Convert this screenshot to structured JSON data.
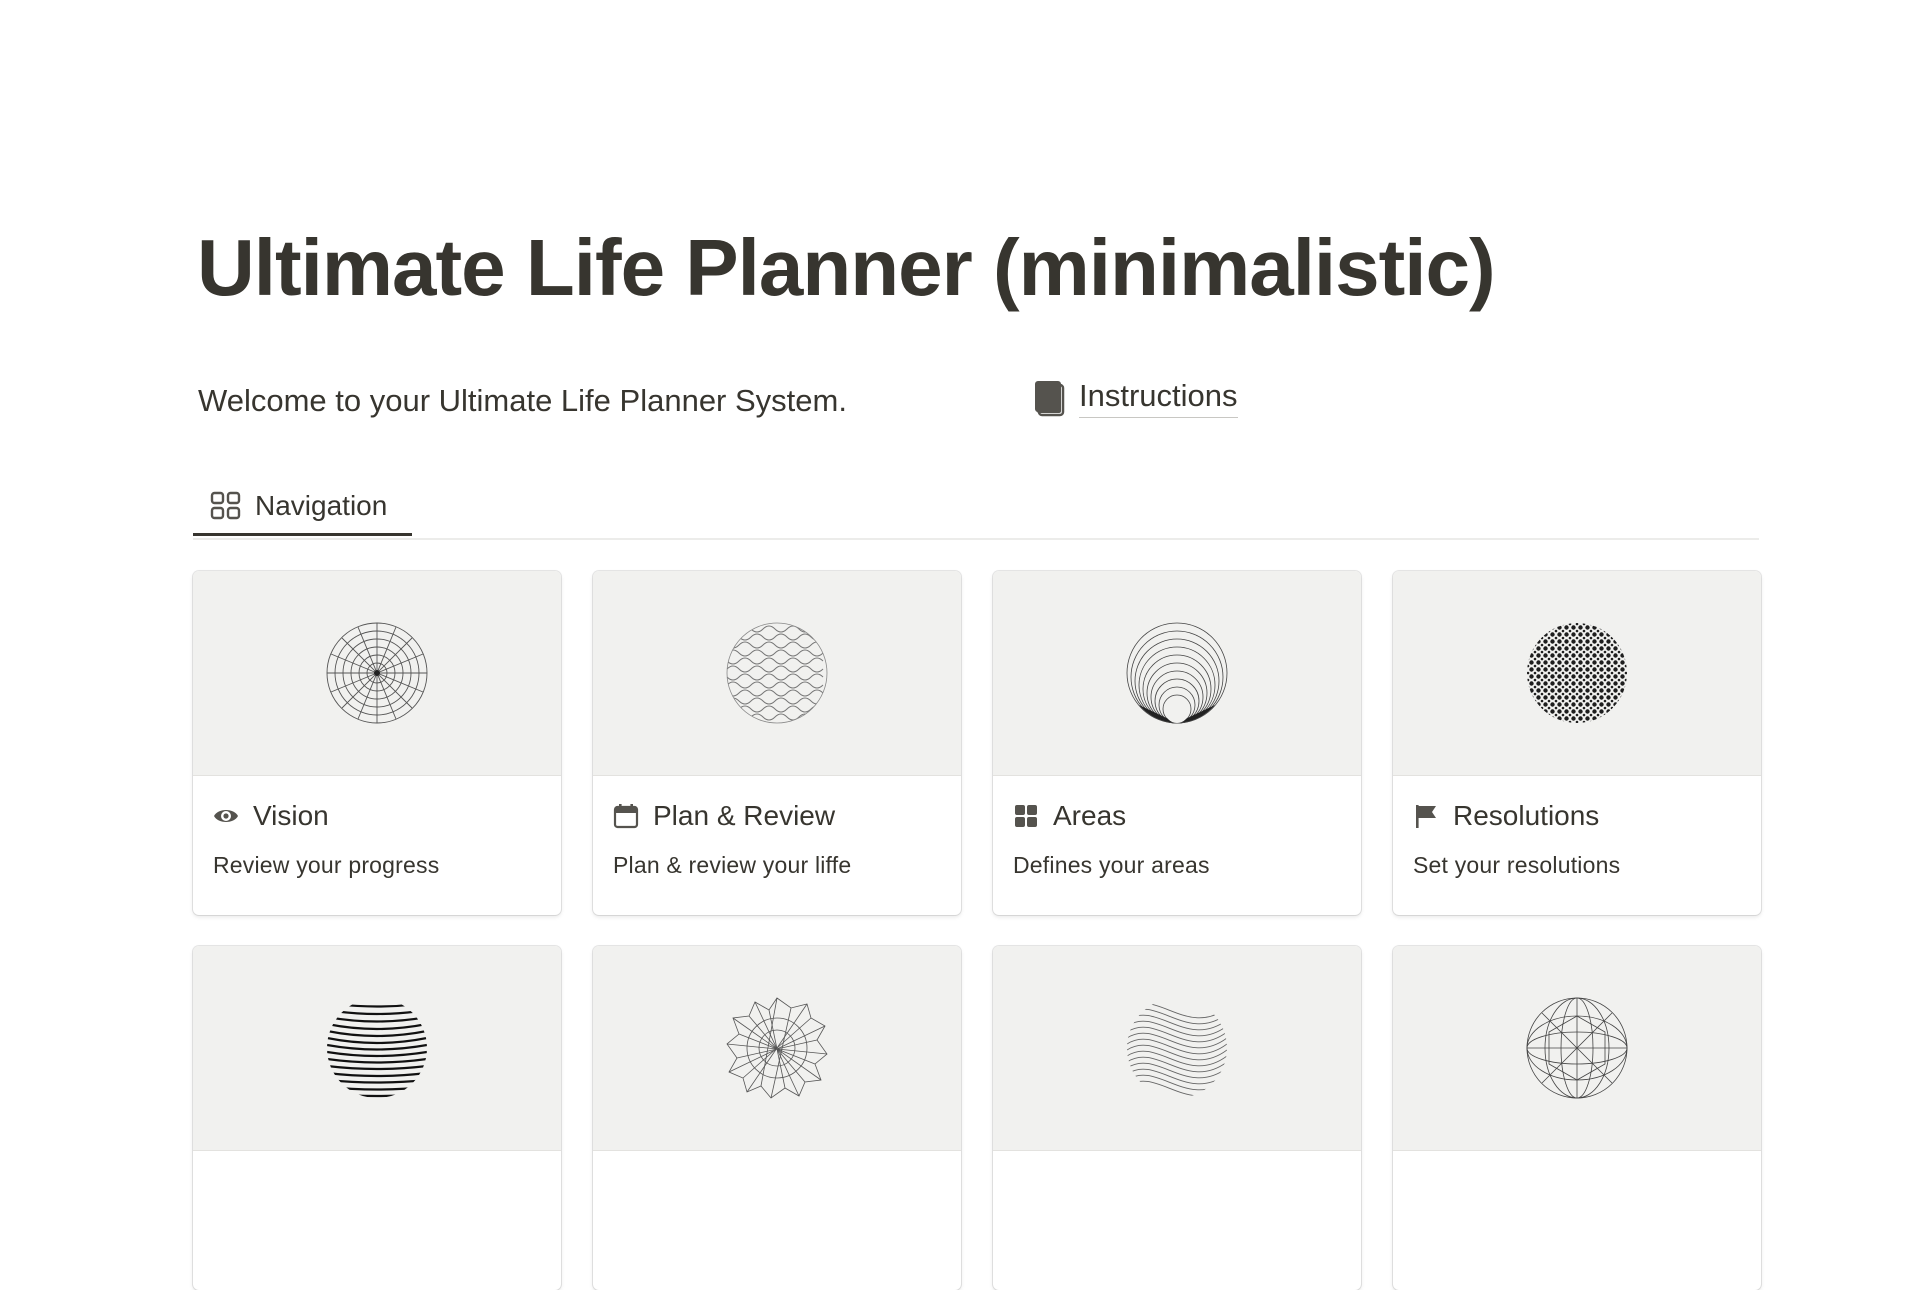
{
  "page": {
    "title": "Ultimate Life Planner (minimalistic)",
    "welcome": "Welcome to your Ultimate Life Planner System.",
    "instructions_link": {
      "label": "Instructions",
      "icon": "book-icon"
    }
  },
  "views": {
    "tabs": [
      {
        "label": "Navigation",
        "icon": "gallery-grid-icon",
        "active": true
      }
    ]
  },
  "gallery": {
    "cards": [
      {
        "title": "Vision",
        "icon": "eye-icon",
        "description": "Review your progress",
        "cover": "polar-grid-sphere"
      },
      {
        "title": "Plan & Review",
        "icon": "calendar-icon",
        "description": "Plan & review your liffe",
        "cover": "maze-sphere"
      },
      {
        "title": "Areas",
        "icon": "grid-squares-icon",
        "description": "Defines your areas",
        "cover": "nested-circles-sphere"
      },
      {
        "title": "Resolutions",
        "icon": "flag-icon",
        "description": "Set your resolutions",
        "cover": "dotted-sphere"
      },
      {
        "title": "",
        "icon": "",
        "description": "",
        "cover": "striped-sphere"
      },
      {
        "title": "",
        "icon": "",
        "description": "",
        "cover": "wireframe-spiky-sphere"
      },
      {
        "title": "",
        "icon": "",
        "description": "",
        "cover": "wave-sphere"
      },
      {
        "title": "",
        "icon": "",
        "description": "",
        "cover": "geodesic-sphere"
      }
    ]
  },
  "colors": {
    "text": "#37352f",
    "cover_background": "#f1f1ef",
    "divider": "#ececea",
    "page_background": "#ffffff"
  }
}
